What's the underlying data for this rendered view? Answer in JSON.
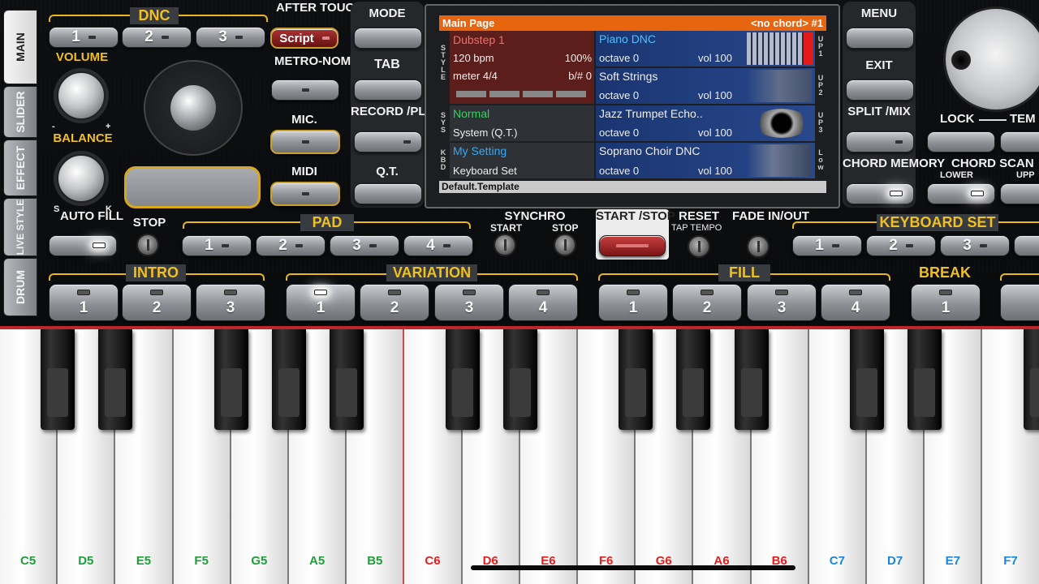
{
  "side_tabs": [
    "MAIN",
    "SLIDER",
    "EFFECT",
    "LIVE STYLE",
    "DRUM"
  ],
  "dnc": {
    "title": "DNC",
    "buttons": [
      "1",
      "2",
      "3"
    ]
  },
  "after_touch": {
    "label": "AFTER TOUCH",
    "script": "Script"
  },
  "metronome": "METRO-NOME",
  "mic": "MIC.",
  "midi": "MIDI",
  "volume": "VOLUME",
  "balance": "BALANCE",
  "balance_minus": "-",
  "balance_plus": "+",
  "s_label": "S",
  "k_label": "K",
  "auto_fill": "AUTO FILL",
  "left_buttons": {
    "mode": "MODE",
    "tab": "TAB",
    "record": "RECORD /PLAY",
    "qt": "Q.T."
  },
  "right_buttons": {
    "menu": "MENU",
    "exit": "EXIT",
    "split": "SPLIT /MIX",
    "chord_memory": "CHORD MEMORY"
  },
  "lock": "LOCK",
  "tempo": "TEM",
  "chord_scan": "CHORD SCAN",
  "lower": "LOWER",
  "upper": "UPP",
  "screen": {
    "title": "Main Page",
    "chord": "<no chord> #1",
    "style_name": "Dubstep 1",
    "bpm": "120 bpm",
    "percent": "100%",
    "meter": "meter 4/4",
    "transpose": "b/# 0",
    "sys_name": "Normal",
    "sys_value": "System (Q.T.)",
    "kbd_name": "My Setting",
    "kbd_value": "Keyboard Set",
    "footer": "Default.Template",
    "style_vert": "STYLE",
    "sys_vert": "SYS",
    "kbd_vert": "KBD",
    "parts": [
      {
        "name": "Piano DNC",
        "octave": "octave  0",
        "vol": "vol 100",
        "tag": "UP1"
      },
      {
        "name": "Soft Strings",
        "octave": "octave  0",
        "vol": "vol 100",
        "tag": "UP2"
      },
      {
        "name": "Jazz Trumpet Echo..",
        "octave": "octave  0",
        "vol": "vol 100",
        "tag": "UP3"
      },
      {
        "name": "Soprano Choir DNC",
        "octave": "octave  0",
        "vol": "vol 100",
        "tag": "Low"
      }
    ]
  },
  "stop": "STOP",
  "pad": {
    "title": "PAD",
    "buttons": [
      "1",
      "2",
      "3",
      "4"
    ]
  },
  "synchro": {
    "title": "SYNCHRO",
    "start": "START",
    "stop": "STOP"
  },
  "start_stop": "START /STOP",
  "reset": "RESET",
  "tap_tempo": "TAP TEMPO",
  "fade": "FADE IN/OUT",
  "keyboard_set": {
    "title": "KEYBOARD SET",
    "buttons": [
      "1",
      "2",
      "3"
    ]
  },
  "intro": {
    "title": "INTRO",
    "buttons": [
      "1",
      "2",
      "3"
    ]
  },
  "variation": {
    "title": "VARIATION",
    "buttons": [
      "1",
      "2",
      "3",
      "4"
    ]
  },
  "fill": {
    "title": "FILL",
    "buttons": [
      "1",
      "2",
      "3",
      "4"
    ]
  },
  "break": {
    "title": "BREAK",
    "buttons": [
      "1"
    ]
  },
  "keys": [
    "C5",
    "D5",
    "E5",
    "F5",
    "G5",
    "A5",
    "B5",
    "C6",
    "D6",
    "E6",
    "F6",
    "G6",
    "A6",
    "B6",
    "C7",
    "D7",
    "E7",
    "F7"
  ],
  "colors": {
    "green": "#1e9e3a",
    "red": "#e22020",
    "blue": "#1a86d8",
    "accent": "#e8b818",
    "screen_header": "#e8650f"
  }
}
